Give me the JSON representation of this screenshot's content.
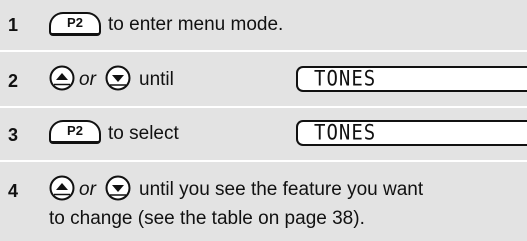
{
  "steps": [
    {
      "number": "1",
      "button": "P2",
      "text": "to enter menu mode."
    },
    {
      "number": "2",
      "connector": "or",
      "text": "until",
      "display": "TONES"
    },
    {
      "number": "3",
      "button": "P2",
      "text": "to select",
      "display": "TONES"
    },
    {
      "number": "4",
      "connector": "or",
      "text_line1": "until you see the feature you want",
      "text_line2": "to change (see the table on page 38)."
    }
  ],
  "icons": {
    "button_p2": "p2-button-icon",
    "up": "up-arrow-button-icon",
    "down": "down-arrow-button-icon"
  },
  "colors": {
    "band": "#e3e3e3",
    "text": "#111111"
  }
}
